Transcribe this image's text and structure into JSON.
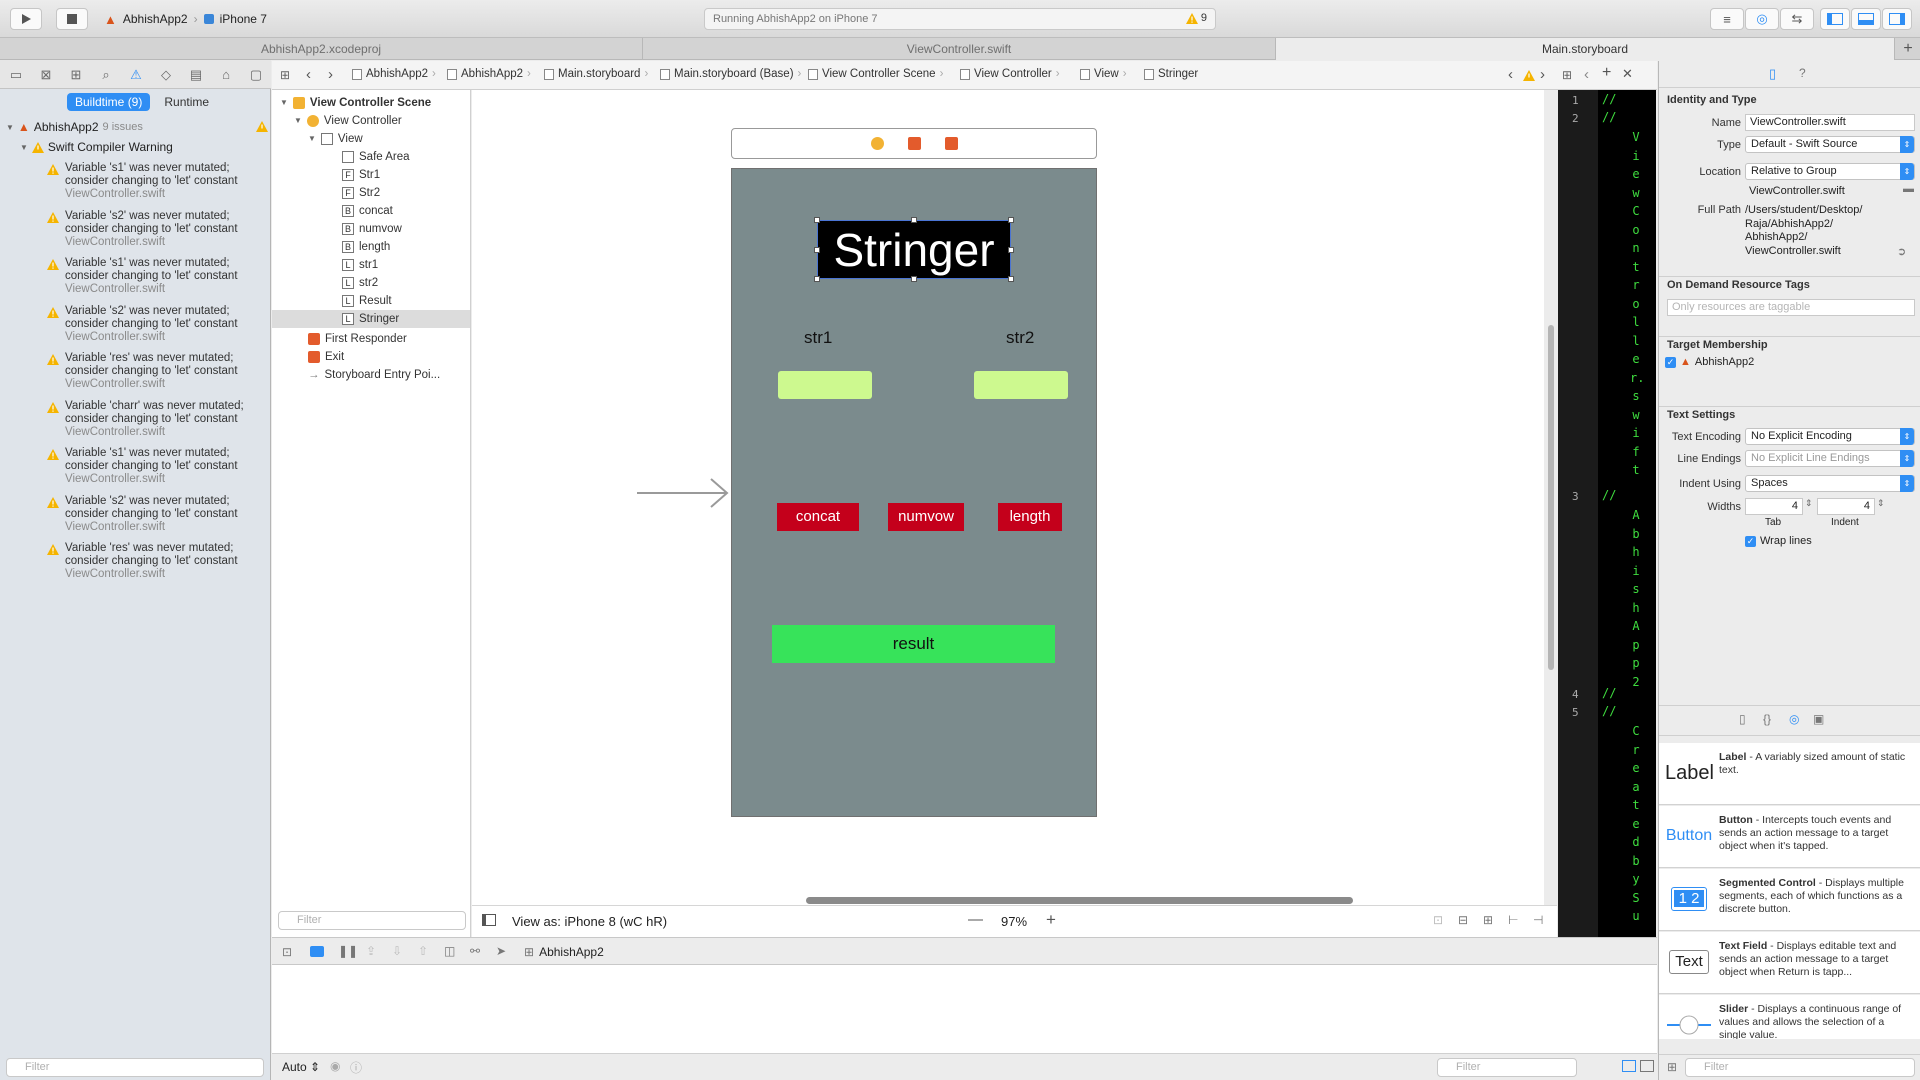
{
  "toolbar": {
    "scheme_name": "AbhishApp2",
    "device": "iPhone 7",
    "status_text": "Running AbhishApp2 on iPhone 7",
    "warning_count": "9"
  },
  "tabs": [
    {
      "label": "AbhishApp2.xcodeproj"
    },
    {
      "label": "ViewController.swift"
    },
    {
      "label": "Main.storyboard"
    }
  ],
  "navigator": {
    "segment_buildtime": "Buildtime (9)",
    "segment_runtime": "Runtime",
    "project_name": "AbhishApp2",
    "project_issues": "9 issues",
    "group_title": "Swift Compiler Warning",
    "issues": [
      {
        "line1": "Variable 's1' was never mutated;",
        "line2": "consider changing to 'let' constant",
        "file": "ViewController.swift"
      },
      {
        "line1": "Variable 's2' was never mutated;",
        "line2": "consider changing to 'let' constant",
        "file": "ViewController.swift"
      },
      {
        "line1": "Variable 's1' was never mutated;",
        "line2": "consider changing to 'let' constant",
        "file": "ViewController.swift"
      },
      {
        "line1": "Variable 's2' was never mutated;",
        "line2": "consider changing to 'let' constant",
        "file": "ViewController.swift"
      },
      {
        "line1": "Variable 'res' was never mutated;",
        "line2": "consider changing to 'let' constant",
        "file": "ViewController.swift"
      },
      {
        "line1": "Variable 'charr' was never mutated;",
        "line2": "consider changing to 'let' constant",
        "file": "ViewController.swift"
      },
      {
        "line1": "Variable 's1' was never mutated;",
        "line2": "consider changing to 'let' constant",
        "file": "ViewController.swift"
      },
      {
        "line1": "Variable 's2' was never mutated;",
        "line2": "consider changing to 'let' constant",
        "file": "ViewController.swift"
      },
      {
        "line1": "Variable 'res' was never mutated;",
        "line2": "consider changing to 'let' constant",
        "file": "ViewController.swift"
      }
    ],
    "filter_placeholder": "Filter"
  },
  "jumpbar": {
    "crumbs": [
      "AbhishApp2",
      "AbhishApp2",
      "Main.storyboard",
      "Main.storyboard (Base)",
      "View Controller Scene",
      "View Controller",
      "View",
      "Stringer"
    ]
  },
  "outline": {
    "scene": "View Controller Scene",
    "view_controller": "View Controller",
    "view": "View",
    "items": [
      {
        "badge": "",
        "label": "Safe Area"
      },
      {
        "badge": "F",
        "label": "Str1"
      },
      {
        "badge": "F",
        "label": "Str2"
      },
      {
        "badge": "B",
        "label": "concat"
      },
      {
        "badge": "B",
        "label": "numvow"
      },
      {
        "badge": "B",
        "label": "length"
      },
      {
        "badge": "L",
        "label": "str1"
      },
      {
        "badge": "L",
        "label": "str2"
      },
      {
        "badge": "L",
        "label": "Result"
      },
      {
        "badge": "L",
        "label": "Stringer"
      }
    ],
    "first_responder": "First Responder",
    "exit": "Exit",
    "entry_point": "Storyboard Entry Poi...",
    "filter_placeholder": "Filter"
  },
  "storyboard": {
    "title_label": "Stringer",
    "label_str1": "str1",
    "label_str2": "str2",
    "btn_concat": "concat",
    "btn_numvow": "numvow",
    "btn_length": "length",
    "result_label": "result"
  },
  "canvas_footer": {
    "view_as": "View as: iPhone 8 (wC hR)",
    "zoom": "97%",
    "zoom_out": "—",
    "zoom_in": "+"
  },
  "code": {
    "lines": [
      {
        "num": "1",
        "text": "//"
      },
      {
        "num": "2",
        "text": "//"
      },
      {
        "num": "3",
        "text": "//"
      },
      {
        "num": "4",
        "text": "//"
      },
      {
        "num": "5",
        "text": "//"
      }
    ],
    "vertical_1": "ViewController.swift",
    "vertical_2": "AbhishApp2",
    "vertical_3": "CreatedbySu"
  },
  "debug": {
    "target": "AbhishApp2",
    "auto": "Auto",
    "filter_placeholder": "Filter"
  },
  "inspector": {
    "identity_header": "Identity and Type",
    "name_label": "Name",
    "name_value": "ViewController.swift",
    "type_label": "Type",
    "type_value": "Default - Swift Source",
    "location_label": "Location",
    "location_value": "Relative to Group",
    "location_file": "ViewController.swift",
    "fullpath_label": "Full Path",
    "fullpath_lines": [
      "/Users/student/Desktop/",
      "Raja/AbhishApp2/",
      "AbhishApp2/",
      "ViewController.swift"
    ],
    "odr_header": "On Demand Resource Tags",
    "odr_placeholder": "Only resources are taggable",
    "target_header": "Target Membership",
    "target_name": "AbhishApp2",
    "text_header": "Text Settings",
    "encoding_label": "Text Encoding",
    "encoding_value": "No Explicit Encoding",
    "endings_label": "Line Endings",
    "endings_value": "No Explicit Line Endings",
    "indent_label": "Indent Using",
    "indent_value": "Spaces",
    "widths_label": "Widths",
    "tab_value": "4",
    "indent_width_value": "4",
    "tab_caption": "Tab",
    "indent_caption": "Indent",
    "wrap_label": "Wrap lines",
    "library": [
      {
        "icon": "Label",
        "name": "Label",
        "desc": " - A variably sized amount of static text."
      },
      {
        "icon": "Button",
        "name": "Button",
        "desc": " - Intercepts touch events and sends an action message to a target object when it's tapped."
      },
      {
        "icon": "1 2",
        "name": "Segmented Control",
        "desc": " - Displays multiple segments, each of which functions as a discrete button."
      },
      {
        "icon": "Text",
        "name": "Text Field",
        "desc": " - Displays editable text and sends an action message to a target object when Return is tapp..."
      },
      {
        "icon": "",
        "name": "Slider",
        "desc": " - Displays a continuous range of values and allows the selection of a single value."
      }
    ],
    "filter_placeholder": "Filter"
  }
}
